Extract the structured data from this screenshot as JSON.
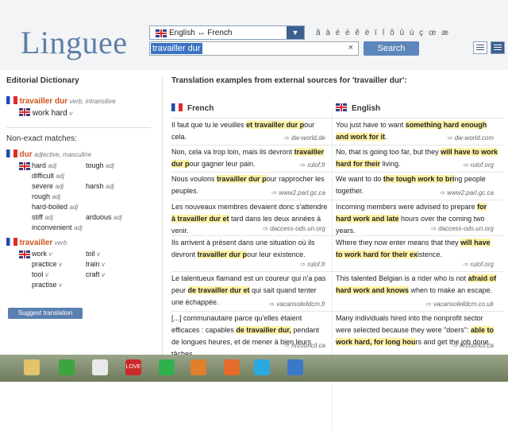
{
  "header": {
    "logo": "Linguee",
    "lang_pair": "English ↔ French",
    "accents": "â à é è ê ë ï î ô û ù ç œ æ",
    "search_value": "travailler dur",
    "clear": "×",
    "search_label": "Search"
  },
  "dictionary": {
    "title": "Editorial Dictionary",
    "main": {
      "term": "travailler dur",
      "pos": "verb, intransitive",
      "translation": "work hard",
      "tpos": "v"
    },
    "nonexact_title": "Non-exact matches:",
    "dur": {
      "term": "dur",
      "pos": "adjective, masculine",
      "rows": [
        [
          "hard",
          "adj",
          "tough",
          "adj"
        ],
        [
          "difficult",
          "adj",
          "",
          ""
        ],
        [
          "severe",
          "adj",
          "harsh",
          "adj"
        ],
        [
          "rough",
          "adj",
          "",
          ""
        ],
        [
          "hard-boiled",
          "adj",
          "",
          ""
        ],
        [
          "stiff",
          "adj",
          "arduous",
          "adj"
        ],
        [
          "inconvenient",
          "adj",
          "",
          ""
        ]
      ]
    },
    "travailler": {
      "term": "travailler",
      "pos": "verb",
      "rows": [
        [
          "work",
          "v",
          "toil",
          "v"
        ],
        [
          "practice",
          "v",
          "train",
          "v"
        ],
        [
          "tool",
          "v",
          "craft",
          "v"
        ],
        [
          "practise",
          "v",
          "",
          ""
        ]
      ]
    },
    "suggest": "Suggest translation"
  },
  "examples": {
    "title": "Translation examples from external sources for 'travailler dur':",
    "col_fr": "French",
    "col_en": "English",
    "rows": [
      {
        "fr": "Il faut que tu le veuilles <h>et travailler dur p</h>our cela.",
        "fr_src": "dw-world.de",
        "en": "You just have to want <h>something hard enough and work for it</h>.",
        "en_src": "dw-world.com"
      },
      {
        "fr": "Non, cela va trop loin, mais ils devront <h>travailler dur p</h>our gagner leur pain.",
        "fr_src": "rulof.fr",
        "en": "No, that is going too far, but they <h>will have to work hard for their</h> living.",
        "en_src": "rulof.org"
      },
      {
        "fr": "Nous voulons <h>travailler dur p</h>our rapprocher les peuples.",
        "fr_src": "www2.parl.gc.ca",
        "en": "We want to do <h>the tough work to bri</h>ng people together.",
        "en_src": "www2.parl.gc.ca"
      },
      {
        "fr": "Les nouveaux membres devaient donc s'attendre <h>à travailler dur et</h> tard dans les deux années à venir.",
        "fr_src": "daccess-ods.un.org",
        "en": "Incoming members were advised to prepare <h>for hard work and late</h> hours over the coming two years.",
        "en_src": "daccess-ods.un.org"
      },
      {
        "fr": "Ils arrivent à présent dans une situation où ils devront <h>travailler dur p</h>our leur existence.",
        "fr_src": "rulof.fr",
        "en": "Where they now enter means that they <h>will have to work hard for their ex</h>istence.",
        "en_src": "rulof.org"
      },
      {
        "fr": "Le talentueux flamand est un coureur qui n'a pas peur <h>de travailler dur et</h> qui sait quand tenter une échappée.",
        "fr_src": "vacansoleildcm.fr",
        "en": "This talented Belgian is a rider who is not <h>afraid of hard work and knows</h> when to make an escape.",
        "en_src": "vacansoleildcm.co.uk"
      },
      {
        "fr": "[...] communautaire parce qu'elles étaient efficaces : capables <h>de travailler dur,</h> pendant de longues heures, et de mener à bien leurs tâches.",
        "fr_src": "hrcouncil.ca",
        "en": "Many individuals hired into the nonprofit sector were selected because they were \"doers\": <h>able to work hard, for long hou</h>rs and get the job done.",
        "en_src": "hrcouncil.ca"
      }
    ]
  },
  "taskbar": {
    "icons": [
      "folder-icon",
      "app-icon",
      "chrome-icon",
      "love-icon",
      "spotify-icon",
      "app2-icon",
      "firefox-icon",
      "skype-icon",
      "ie-icon"
    ],
    "love_label": "LOVE"
  }
}
